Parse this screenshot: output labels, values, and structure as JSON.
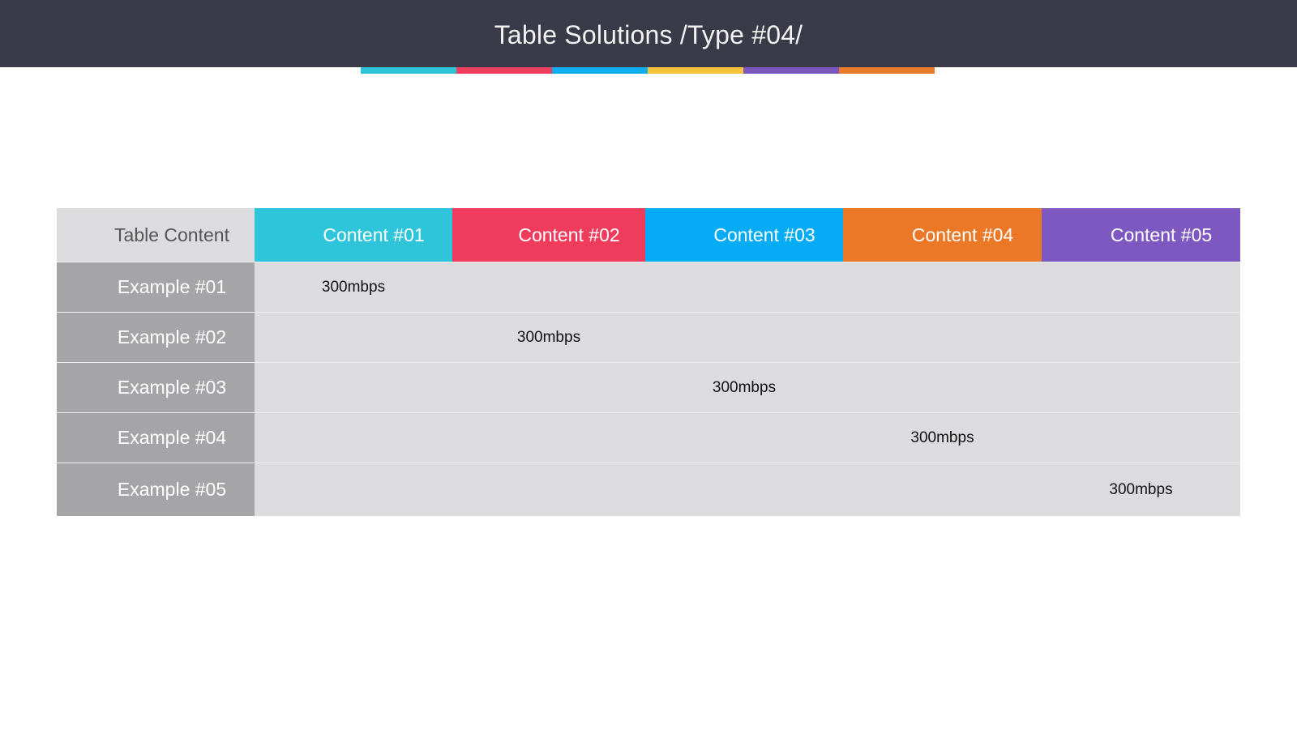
{
  "title": "Table Solutions /Type #04/",
  "strip_colors": [
    "#2ec4da",
    "#ef3f5f",
    "#0eaef2",
    "#f8c53a",
    "#7b58c0",
    "#ea7a2c"
  ],
  "table": {
    "corner_label": "Table Content",
    "columns": [
      {
        "label": "Content #01",
        "color": "#2ec4da"
      },
      {
        "label": "Content #02",
        "color": "#ef3c5c"
      },
      {
        "label": "Content #03",
        "color": "#05acf5"
      },
      {
        "label": "Content #04",
        "color": "#ea7826"
      },
      {
        "label": "Content #05",
        "color": "#7c58c0"
      }
    ],
    "rows": [
      {
        "label": "Example #01",
        "cells": [
          "300mbps",
          "",
          "",
          "",
          ""
        ]
      },
      {
        "label": "Example #02",
        "cells": [
          "",
          "300mbps",
          "",
          "",
          ""
        ]
      },
      {
        "label": "Example #03",
        "cells": [
          "",
          "",
          "300mbps",
          "",
          ""
        ]
      },
      {
        "label": "Example #04",
        "cells": [
          "",
          "",
          "",
          "300mbps",
          ""
        ]
      },
      {
        "label": "Example #05",
        "cells": [
          "",
          "",
          "",
          "",
          "300mbps"
        ]
      }
    ]
  }
}
